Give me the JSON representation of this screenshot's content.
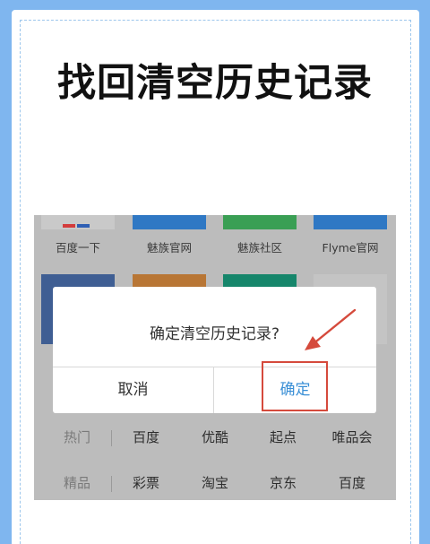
{
  "headline": "找回清空历史记录",
  "bookmarks_top": [
    {
      "label": "百度一下",
      "color": "#c9c9c9"
    },
    {
      "label": "魅族官网",
      "color": "#2f78c4"
    },
    {
      "label": "魅族社区",
      "color": "#3a9f54"
    },
    {
      "label": "Flyme官网",
      "color": "#2f78c4"
    }
  ],
  "bookmarks_middle_colors": [
    "#3f5e93",
    "#b87635",
    "#16866b",
    "#c4c4c4"
  ],
  "dialog": {
    "message": "确定清空历史记录?",
    "cancel_label": "取消",
    "confirm_label": "确定"
  },
  "tag_rows": [
    {
      "head": "热门",
      "items": [
        "百度",
        "优酷",
        "起点",
        "唯品会"
      ]
    },
    {
      "head": "精品",
      "items": [
        "彩票",
        "淘宝",
        "京东",
        "百度"
      ]
    }
  ],
  "colors": {
    "background": "#7fb6ef",
    "accent": "#3a8fd6",
    "annotation_red": "#d54a3c"
  }
}
